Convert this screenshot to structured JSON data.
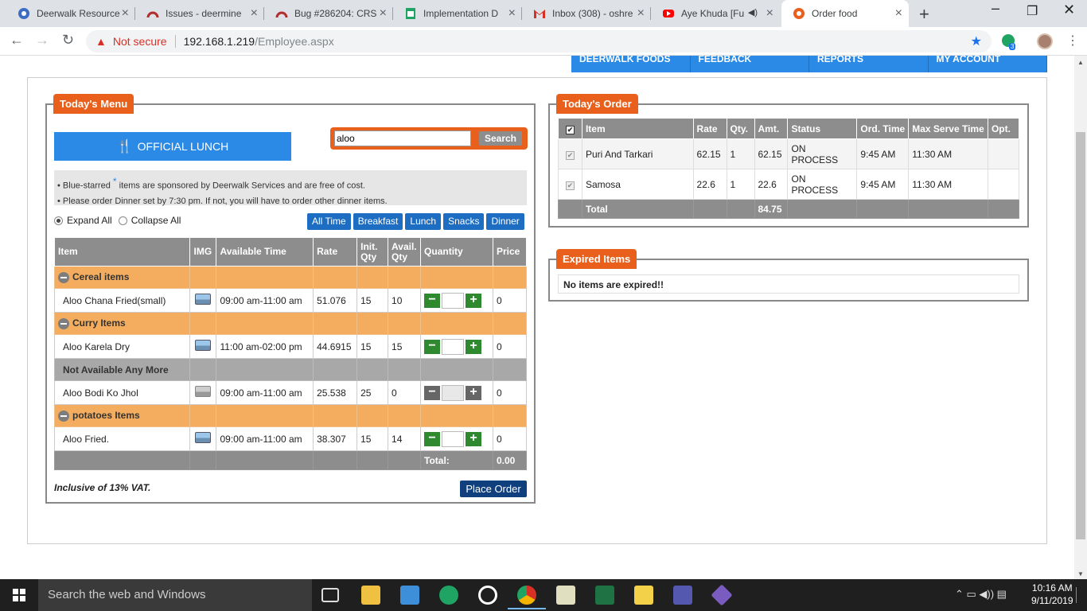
{
  "tabs": [
    {
      "title": "Deerwalk Resource",
      "icon": "deerwalk-icon",
      "color": "#3b6ec2"
    },
    {
      "title": "Issues - deermine",
      "icon": "redmine-icon",
      "color": "#b32d2d"
    },
    {
      "title": "Bug #286204: CRS",
      "icon": "redmine-icon",
      "color": "#b32d2d"
    },
    {
      "title": "Implementation D",
      "icon": "sheets-icon",
      "color": "#1fa463"
    },
    {
      "title": "Inbox (308) - oshre",
      "icon": "gmail-icon",
      "color": "#d93025"
    },
    {
      "title": "Aye Khuda [Fu",
      "icon": "youtube-icon",
      "color": "#ff0000"
    },
    {
      "title": "Order food",
      "icon": "deerwalk-foods-icon",
      "color": "#e8601c"
    }
  ],
  "address": {
    "warning": "Not secure",
    "host": "192.168.1.219",
    "path": "/Employee.aspx"
  },
  "extension_badge": "3",
  "topnav": [
    "Deerwalk Foods",
    "Feedback",
    "Reports",
    "My Account"
  ],
  "menu": {
    "legend": "Today's Menu",
    "official_lunch": "OFFICIAL LUNCH",
    "search_value": "aloo",
    "search_button": "Search",
    "note1_a": "• Blue-starred ",
    "note1_star": "*",
    "note1_b": " items are sponsored by Deerwalk Services and are free of cost.",
    "note2": "• Please order Dinner set by 7:30 pm. If not, you will have to order other dinner items.",
    "expand_all": "Expand All",
    "collapse_all": "Collapse All",
    "filters": [
      "All Time",
      "Breakfast",
      "Lunch",
      "Snacks",
      "Dinner"
    ],
    "columns": {
      "item": "Item",
      "img": "IMG",
      "time": "Available Time",
      "rate": "Rate",
      "init1": "Init.",
      "init2": "Qty",
      "avail1": "Avail.",
      "avail2": "Qty",
      "quantity": "Quantity",
      "price": "Price"
    },
    "groups": [
      {
        "name": "Cereal items",
        "items": [
          {
            "name": "Aloo Chana Fried(small)",
            "time": "09:00 am-11:00 am",
            "rate": "51.076",
            "init": "15",
            "avail": "10",
            "price": "0"
          }
        ]
      },
      {
        "name": "Curry Items",
        "items": [
          {
            "name": "Aloo Karela Dry",
            "time": "11:00 am-02:00 pm",
            "rate": "44.6915",
            "init": "15",
            "avail": "15",
            "price": "0"
          }
        ]
      },
      {
        "name": "Not Available Any More",
        "items": [
          {
            "name": "Aloo Bodi Ko Jhol",
            "time": "09:00 am-11:00 am",
            "rate": "25.538",
            "init": "25",
            "avail": "0",
            "price": "0"
          }
        ]
      },
      {
        "name": "potatoes Items",
        "items": [
          {
            "name": "Aloo Fried.",
            "time": "09:00 am-11:00 am",
            "rate": "38.307",
            "init": "15",
            "avail": "14",
            "price": "0"
          }
        ]
      }
    ],
    "total_label": "Total:",
    "total_value": "0.00",
    "vat_note": "Inclusive of 13% VAT.",
    "place_order": "Place Order"
  },
  "order": {
    "legend": "Today's Order",
    "columns": {
      "check": "✔",
      "item": "Item",
      "rate": "Rate",
      "qty": "Qty.",
      "amt": "Amt.",
      "status": "Status",
      "ord": "Ord. Time",
      "max": "Max Serve Time",
      "opt": "Opt."
    },
    "rows": [
      {
        "item": "Puri And Tarkari",
        "rate": "62.15",
        "qty": "1",
        "amt": "62.15",
        "status": "ON PROCESS",
        "ord": "9:45 AM",
        "max": "11:30 AM"
      },
      {
        "item": "Samosa",
        "rate": "22.6",
        "qty": "1",
        "amt": "22.6",
        "status": "ON PROCESS",
        "ord": "9:45 AM",
        "max": "11:30 AM"
      }
    ],
    "total_label": "Total",
    "total_amt": "84.75"
  },
  "expired": {
    "legend": "Expired Items",
    "message": "No items are expired!!"
  },
  "taskbar": {
    "search": "Search the web and Windows",
    "time": "10:16 AM",
    "date": "9/11/2019"
  }
}
